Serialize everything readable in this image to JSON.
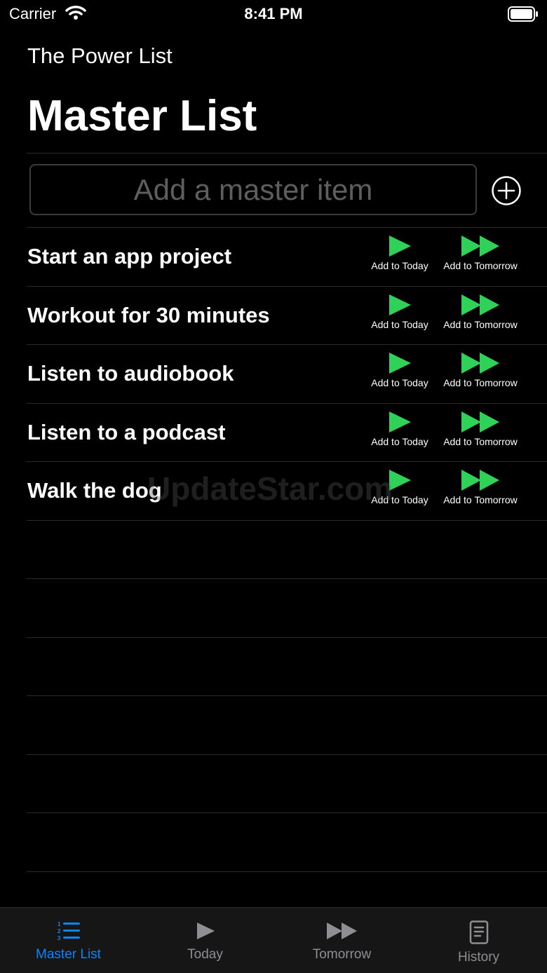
{
  "status_bar": {
    "carrier": "Carrier",
    "time": "8:41 PM"
  },
  "header": {
    "app_title": "The Power List",
    "page_title": "Master List"
  },
  "add_item": {
    "placeholder": "Add a master item",
    "value": ""
  },
  "actions": {
    "today_label": "Add to Today",
    "tomorrow_label": "Add to Tomorrow"
  },
  "items": [
    {
      "title": "Start an app project"
    },
    {
      "title": "Workout for 30 minutes"
    },
    {
      "title": "Listen to audiobook"
    },
    {
      "title": "Listen to a podcast"
    },
    {
      "title": "Walk the dog"
    }
  ],
  "watermark": "UpdateStar.com",
  "tabs": [
    {
      "label": "Master List",
      "icon": "list-icon",
      "active": true
    },
    {
      "label": "Today",
      "icon": "play-icon",
      "active": false
    },
    {
      "label": "Tomorrow",
      "icon": "fast-forward-icon",
      "active": false
    },
    {
      "label": "History",
      "icon": "document-icon",
      "active": false
    }
  ],
  "colors": {
    "accent": "#0a84ff",
    "action_green": "#30d158",
    "inactive": "#8e8e93"
  }
}
